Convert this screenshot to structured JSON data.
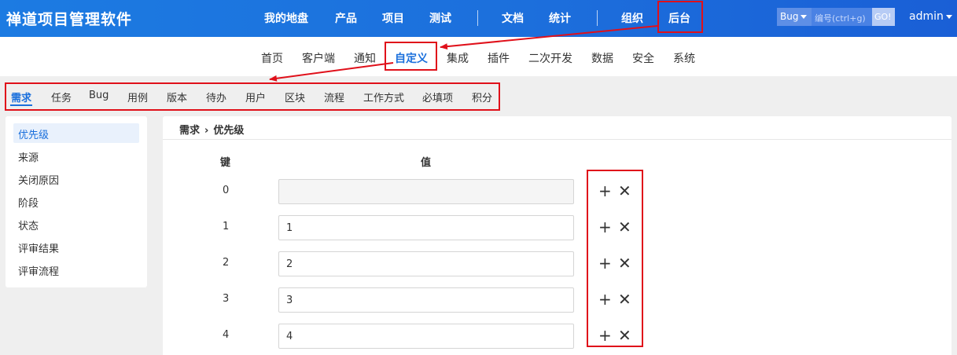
{
  "header": {
    "brand": "禅道项目管理软件",
    "nav": [
      "我的地盘",
      "产品",
      "项目",
      "测试",
      "文档",
      "统计",
      "组织",
      "后台"
    ],
    "active_nav": "后台",
    "search": {
      "type": "Bug",
      "placeholder": "编号(ctrl+g)",
      "go": "GO!"
    },
    "user": "admin"
  },
  "subnav": {
    "items": [
      "首页",
      "客户端",
      "通知",
      "自定义",
      "集成",
      "插件",
      "二次开发",
      "数据",
      "安全",
      "系统"
    ],
    "active": "自定义"
  },
  "tabs": {
    "items": [
      "需求",
      "任务",
      "Bug",
      "用例",
      "版本",
      "待办",
      "用户",
      "区块",
      "流程",
      "工作方式",
      "必填项",
      "积分"
    ],
    "active": "需求"
  },
  "sidebar": {
    "items": [
      "优先级",
      "来源",
      "关闭原因",
      "阶段",
      "状态",
      "评审结果",
      "评审流程"
    ],
    "active": "优先级"
  },
  "main": {
    "breadcrumb": [
      "需求",
      "优先级"
    ],
    "columns": {
      "key": "键",
      "value": "值"
    },
    "rows": [
      {
        "key": "0",
        "value": ""
      },
      {
        "key": "1",
        "value": "1"
      },
      {
        "key": "2",
        "value": "2"
      },
      {
        "key": "3",
        "value": "3"
      },
      {
        "key": "4",
        "value": "4"
      }
    ],
    "add_symbol": "+",
    "remove_symbol": "✕"
  },
  "colors": {
    "header_blue": "#1c7be2",
    "accent": "#1a6fdc",
    "annotation_red": "#e0101a"
  }
}
